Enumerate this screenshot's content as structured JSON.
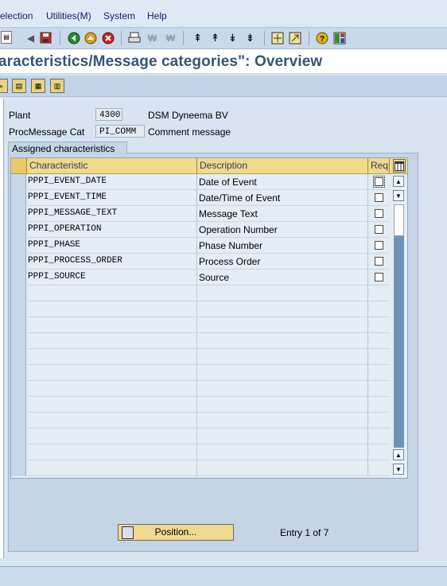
{
  "menu": {
    "items": [
      "election",
      "Utilities(M)",
      "System",
      "Help"
    ]
  },
  "toolbar": {
    "icons": [
      "enter-icon",
      "back-icon",
      "save-icon",
      "back-nav-icon",
      "exit-icon",
      "cancel-icon",
      "print-icon",
      "find-icon",
      "find-next-icon",
      "first-page-icon",
      "prev-page-icon",
      "next-page-icon",
      "last-page-icon",
      "create-session-icon",
      "shortcut-icon",
      "help-icon",
      "layout-icon"
    ]
  },
  "title": "aracteristics/Message categories\": Overview",
  "header_fields": {
    "plant_label": "Plant",
    "plant_value": "4300",
    "plant_desc": "DSM Dyneema BV",
    "procmsg_label": "ProcMessage Cat",
    "procmsg_value": "PI_COMM",
    "procmsg_desc": "Comment message"
  },
  "group": {
    "title": "Assigned characteristics"
  },
  "table": {
    "columns": [
      "Characteristic",
      "Description",
      "Req"
    ],
    "rows": [
      {
        "characteristic": "PPPI_EVENT_DATE",
        "description": "Date of Event"
      },
      {
        "characteristic": "PPPI_EVENT_TIME",
        "description": "Date/Time of Event"
      },
      {
        "characteristic": "PPPI_MESSAGE_TEXT",
        "description": "Message Text"
      },
      {
        "characteristic": "PPPI_OPERATION",
        "description": "Operation Number"
      },
      {
        "characteristic": "PPPI_PHASE",
        "description": "Phase Number"
      },
      {
        "characteristic": "PPPI_PROCESS_ORDER",
        "description": "Process Order"
      },
      {
        "characteristic": "PPPI_SOURCE",
        "description": "Source"
      }
    ]
  },
  "footer": {
    "position_label": "Position...",
    "entry_text": "Entry 1 of 7"
  },
  "colors": {
    "header_accent": "#f1d98b",
    "title_text": "#335577",
    "scroll_track": "#6f93b5"
  }
}
